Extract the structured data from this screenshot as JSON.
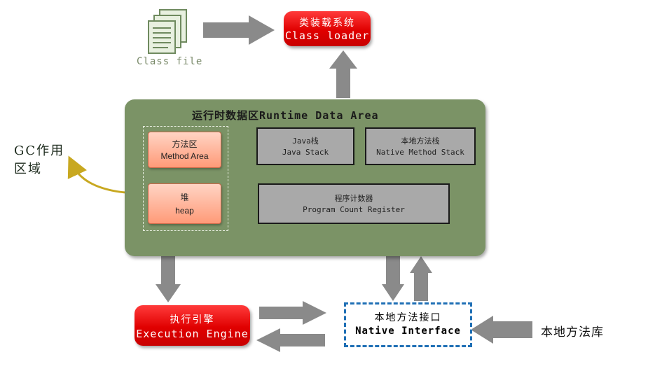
{
  "class_file": {
    "label": "Class file",
    "icon": "document-stack-icon"
  },
  "class_loader": {
    "title_cn": "类装载系统",
    "title_en": "Class loader"
  },
  "runtime_area": {
    "title": "运行时数据区Runtime Data Area",
    "method_area": {
      "cn": "方法区",
      "en": "Method Area"
    },
    "heap": {
      "cn": "堆",
      "en": "heap"
    },
    "java_stack": {
      "cn": "Java栈",
      "en": "Java Stack"
    },
    "native_stack": {
      "cn": "本地方法栈",
      "en": "Native Method Stack"
    },
    "pc_register": {
      "cn": "程序计数器",
      "en": "Program Count Register"
    }
  },
  "gc_label": "GC作用区域",
  "execution_engine": {
    "cn": "执行引擎",
    "en": "Execution Engine"
  },
  "native_interface": {
    "cn": "本地方法接口",
    "en": "Native Interface"
  },
  "native_library": "本地方法库",
  "colors": {
    "red_box": "#e00000",
    "runtime_green": "#7b9366",
    "pink_box": "#ff9a78",
    "grey_box": "#a9a9a9",
    "arrow_grey": "#8a8a8a",
    "native_border": "#1f6fb5",
    "gc_arrow": "#c8a820"
  }
}
